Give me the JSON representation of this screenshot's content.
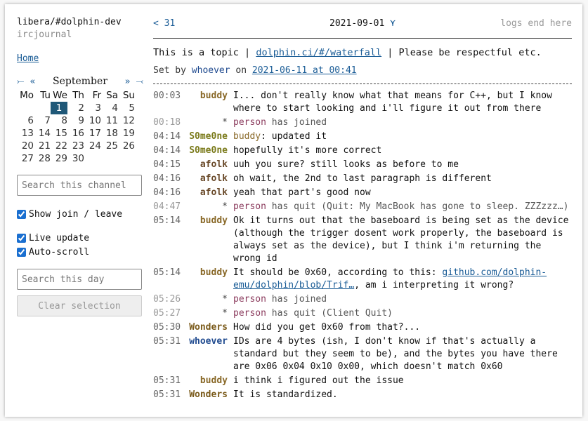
{
  "sidebar": {
    "channel": "libera/#dolphin-dev",
    "network": "ircjournal",
    "home": "Home",
    "cal_first": "⤚",
    "cal_prev": "«",
    "month": "September",
    "cal_next": "»",
    "cal_last": "⤙",
    "weekdays": [
      "Mo",
      "Tu",
      "We",
      "Th",
      "Fr",
      "Sa",
      "Su"
    ],
    "weeks": [
      [
        "",
        "",
        "",
        "1",
        "2",
        "3",
        "4",
        "5"
      ],
      [
        "6",
        "7",
        "8",
        "9",
        "10",
        "11",
        "12"
      ],
      [
        "13",
        "14",
        "15",
        "16",
        "17",
        "18",
        "19"
      ],
      [
        "20",
        "21",
        "22",
        "23",
        "24",
        "25",
        "26"
      ],
      [
        "27",
        "28",
        "29",
        "30",
        "",
        "",
        ""
      ]
    ],
    "selected_day": "1",
    "search_channel_placeholder": "Search this channel",
    "show_join_leave": "Show join / leave",
    "live_update": "Live update",
    "auto_scroll": "Auto-scroll",
    "search_day_placeholder": "Search this day",
    "clear_selection": "Clear selection"
  },
  "header": {
    "prev": "< 31",
    "date": "2021-09-01",
    "date_chevron": "⋎",
    "end": "logs end here"
  },
  "topic": {
    "pre": "This is a topic | ",
    "link": "dolphin.ci/#/waterfall",
    "post": " | Please be respectful etc.",
    "set_by_label": "Set by ",
    "setter": "whoever",
    "on_label": " on ",
    "set_at": "2021-06-11 at 00:41"
  },
  "messages": [
    {
      "time": "00:03",
      "nick": "buddy",
      "text": "I... don't really know what that means for C++, but I know where to start looking and i'll figure it out from there"
    },
    {
      "time": "00:18",
      "event": true,
      "nick": "*",
      "who": "person",
      "text": " has joined"
    },
    {
      "time": "04:14",
      "nick": "S0me0ne",
      "pre": "buddy",
      "text": ": updated it"
    },
    {
      "time": "04:14",
      "nick": "S0me0ne",
      "text": "hopefully it's more correct"
    },
    {
      "time": "04:15",
      "nick": "afolk",
      "text": "uuh you sure? still looks as before to me"
    },
    {
      "time": "04:16",
      "nick": "afolk",
      "text": "oh wait, the 2nd to last paragraph is different"
    },
    {
      "time": "04:16",
      "nick": "afolk",
      "text": "yeah that part's good now"
    },
    {
      "time": "04:47",
      "event": true,
      "nick": "*",
      "who": "person",
      "text": " has quit (Quit: My MacBook has gone to sleep. ZZZzzz…)"
    },
    {
      "time": "05:14",
      "nick": "buddy",
      "text": "Ok it turns out that the baseboard is being set as the device (although the trigger dosent work properly, the baseboard is always set as the device), but I think i'm returning the wrong id"
    },
    {
      "time": "05:14",
      "nick": "buddy",
      "text": "It should be 0x60, according to this: ",
      "link": "github.com/dolphin-emu/dolphin/blob/Trif…",
      "post": ", am i interpreting it wrong?"
    },
    {
      "time": "05:26",
      "event": true,
      "nick": "*",
      "who": "person",
      "text": " has joined"
    },
    {
      "time": "05:27",
      "event": true,
      "nick": "*",
      "who": "person",
      "text": " has quit (Client Quit)"
    },
    {
      "time": "05:30",
      "nick": "Wonders",
      "text": "How did you get 0x60 from that?..."
    },
    {
      "time": "05:31",
      "nick": "whoever",
      "text": "IDs are 4 bytes (ish, I don't know if that's actually a standard but they seem to be), and the bytes you have there are 0x06 0x04 0x10 0x00, which doesn't match 0x60"
    },
    {
      "time": "05:31",
      "nick": "buddy",
      "text": "i think i figured out the issue"
    },
    {
      "time": "05:31",
      "nick": "Wonders",
      "text": "It is standardized."
    }
  ],
  "colors": {
    "selected_day_bg": "#1f5878",
    "link": "#1a5c96",
    "buddy": "#8a6a2a",
    "S0me0ne": "#7a7a1a",
    "afolk": "#6a4a2a",
    "Wonders": "#7a5a1a",
    "whoever": "#1f4a8f",
    "event_person": "#8a3a5c"
  }
}
